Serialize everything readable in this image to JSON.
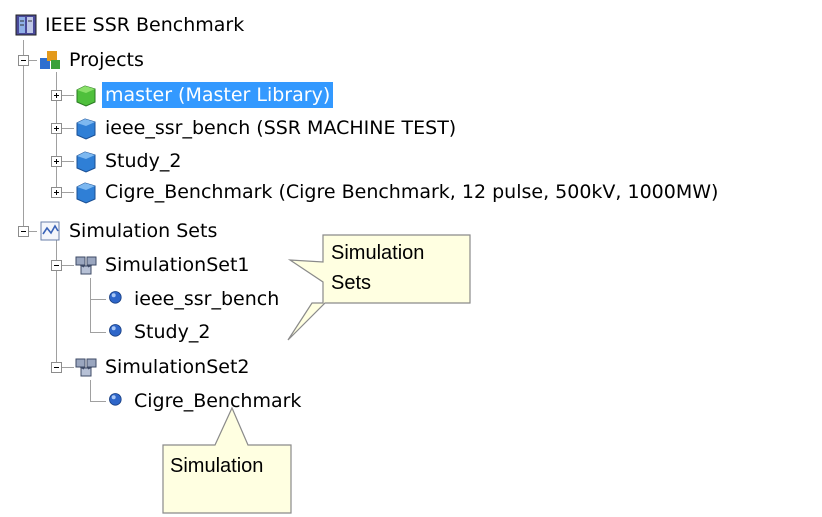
{
  "tree": {
    "root": {
      "label": "IEEE SSR Benchmark",
      "icon": "workspace-icon"
    },
    "projects": {
      "label": "Projects",
      "icon": "projects-folder-icon",
      "items": [
        {
          "label": "master (Master Library)",
          "icon": "library-cube-icon",
          "selected": true
        },
        {
          "label": "ieee_ssr_bench (SSR MACHINE TEST)",
          "icon": "case-cube-icon"
        },
        {
          "label": "Study_2",
          "icon": "case-cube-icon"
        },
        {
          "label": "Cigre_Benchmark (Cigre Benchmark, 12 pulse, 500kV, 1000MW)",
          "icon": "case-cube-icon"
        }
      ]
    },
    "simulation_sets": {
      "label": "Simulation Sets",
      "icon": "simulation-sets-icon",
      "sets": [
        {
          "label": "SimulationSet1",
          "icon": "simulation-set-icon",
          "tasks": [
            {
              "label": "ieee_ssr_bench"
            },
            {
              "label": "Study_2"
            }
          ]
        },
        {
          "label": "SimulationSet2",
          "icon": "simulation-set-icon",
          "tasks": [
            {
              "label": "Cigre_Benchmark"
            }
          ]
        }
      ]
    }
  },
  "callouts": {
    "simulation_sets": {
      "line1": "Simulation",
      "line2": "Sets"
    },
    "simulation": {
      "text": "Simulation"
    }
  },
  "colors": {
    "selection": "#3399ff",
    "callout_fill": "#ffffe1",
    "tree_lines": "#a0a0a0"
  }
}
